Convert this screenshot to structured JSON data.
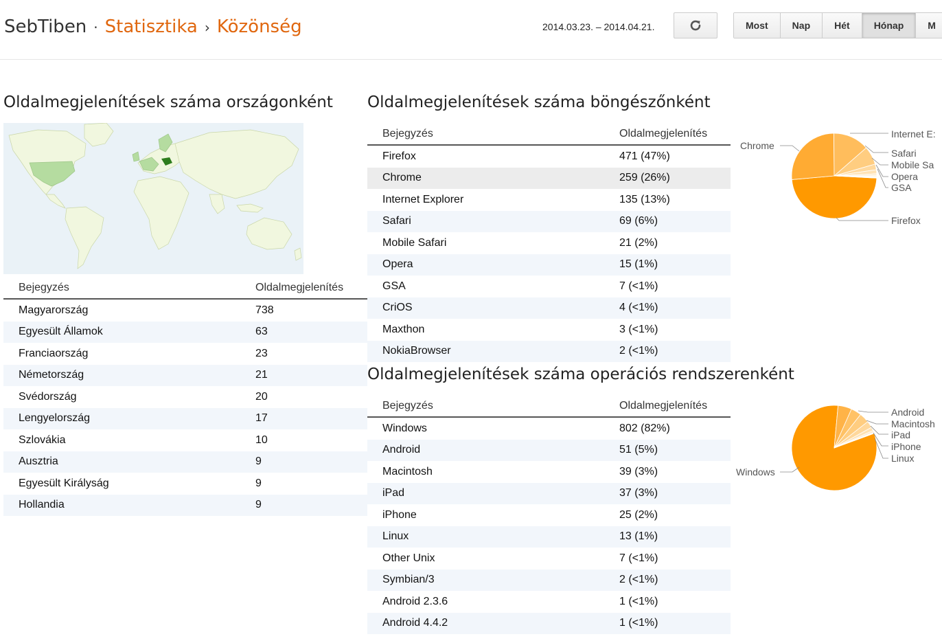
{
  "header": {
    "site": "SebTiben",
    "crumb_sep1": "·",
    "crumb1": "Statisztika",
    "crumb_sep2": "›",
    "crumb2": "Közönség",
    "date_range": "2014.03.23. – 2014.04.21.",
    "refresh_icon": "refresh-icon",
    "ranges": [
      {
        "label": "Most"
      },
      {
        "label": "Nap"
      },
      {
        "label": "Hét"
      },
      {
        "label": "Hónap",
        "active": true
      },
      {
        "label": "M"
      }
    ]
  },
  "countries": {
    "title": "Oldalmegjelenítések száma országonként",
    "col1": "Bejegyzés",
    "col2": "Oldalmegjelenítés",
    "rows": [
      {
        "name": "Magyarország",
        "value": "738"
      },
      {
        "name": "Egyesült Államok",
        "value": "63"
      },
      {
        "name": "Franciaország",
        "value": "23"
      },
      {
        "name": "Németország",
        "value": "21"
      },
      {
        "name": "Svédország",
        "value": "20"
      },
      {
        "name": "Lengyelország",
        "value": "17"
      },
      {
        "name": "Szlovákia",
        "value": "10"
      },
      {
        "name": "Ausztria",
        "value": "9"
      },
      {
        "name": "Egyesült Királyság",
        "value": "9"
      },
      {
        "name": "Hollandia",
        "value": "9"
      }
    ]
  },
  "browsers": {
    "title": "Oldalmegjelenítések száma böngészőnként",
    "col1": "Bejegyzés",
    "col2": "Oldalmegjelenítés",
    "rows": [
      {
        "name": "Firefox",
        "value": "471 (47%)"
      },
      {
        "name": "Chrome",
        "value": "259 (26%)"
      },
      {
        "name": "Internet Explorer",
        "value": "135 (13%)"
      },
      {
        "name": "Safari",
        "value": "69 (6%)"
      },
      {
        "name": "Mobile Safari",
        "value": "21 (2%)"
      },
      {
        "name": "Opera",
        "value": "15 (1%)"
      },
      {
        "name": "GSA",
        "value": "7 (<1%)"
      },
      {
        "name": "CriOS",
        "value": "4 (<1%)"
      },
      {
        "name": "Maxthon",
        "value": "3 (<1%)"
      },
      {
        "name": "NokiaBrowser",
        "value": "2 (<1%)"
      }
    ],
    "pie_labels": [
      "Chrome",
      "Internet E:",
      "Safari",
      "Mobile Sa",
      "Opera",
      "GSA",
      "Firefox"
    ]
  },
  "os": {
    "title": "Oldalmegjelenítések száma operációs rendszerenként",
    "col1": "Bejegyzés",
    "col2": "Oldalmegjelenítés",
    "rows": [
      {
        "name": "Windows",
        "value": "802 (82%)"
      },
      {
        "name": "Android",
        "value": "51 (5%)"
      },
      {
        "name": "Macintosh",
        "value": "39 (3%)"
      },
      {
        "name": "iPad",
        "value": "37 (3%)"
      },
      {
        "name": "iPhone",
        "value": "25 (2%)"
      },
      {
        "name": "Linux",
        "value": "13 (1%)"
      },
      {
        "name": "Other Unix",
        "value": "7 (<1%)"
      },
      {
        "name": "Symbian/3",
        "value": "2 (<1%)"
      },
      {
        "name": "Android 2.3.6",
        "value": "1 (<1%)"
      },
      {
        "name": "Android 4.4.2",
        "value": "1 (<1%)"
      }
    ],
    "pie_labels": [
      "Android",
      "Macintosh",
      "iPad",
      "iPhone",
      "Linux",
      "Windows"
    ]
  },
  "chart_data": [
    {
      "type": "pie",
      "categories": [
        "Firefox",
        "Chrome",
        "Internet Explorer",
        "Safari",
        "Mobile Safari",
        "Opera",
        "GSA",
        "CriOS",
        "Maxthon",
        "NokiaBrowser"
      ],
      "values": [
        471,
        259,
        135,
        69,
        21,
        15,
        7,
        4,
        3,
        2
      ],
      "colors": [
        "#ff9900",
        "#ffab33",
        "#ffbd5c",
        "#ffcd80",
        "#ffd99e",
        "#ffe3b6",
        "#ffeccb",
        "#fff0d6",
        "#fff3df",
        "#fff6e8"
      ]
    },
    {
      "type": "pie",
      "categories": [
        "Windows",
        "Android",
        "Macintosh",
        "iPad",
        "iPhone",
        "Linux",
        "Other Unix",
        "Symbian/3",
        "Android 2.3.6",
        "Android 4.4.2"
      ],
      "values": [
        802,
        51,
        39,
        37,
        25,
        13,
        7,
        2,
        1,
        1
      ],
      "colors": [
        "#ff9900",
        "#ffb347",
        "#ffc266",
        "#ffcd80",
        "#ffd89c",
        "#ffe2b3",
        "#ffeacc",
        "#fff0d6",
        "#fff3df",
        "#fff6e8"
      ]
    }
  ],
  "colors": {
    "accent": "#e0670f",
    "map_land": "#f1f7df",
    "map_water": "#eaf2f7",
    "map_highlight": "#b5dca0",
    "map_top": "#2e7d1e"
  }
}
